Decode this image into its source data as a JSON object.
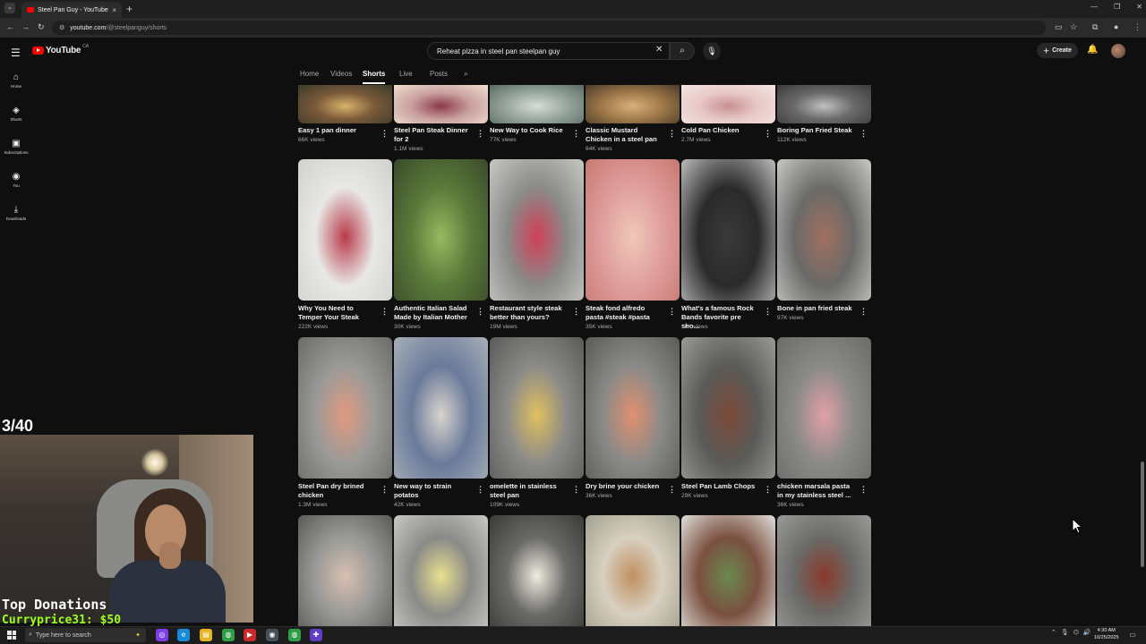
{
  "browser": {
    "tab_title": "Steel Pan Guy - YouTube",
    "url_host": "youtube.com",
    "url_path": "/@steelpanguy/shorts",
    "new_tab": "+",
    "close": "×"
  },
  "masthead": {
    "logo_text": "YouTube",
    "logo_region": "CA",
    "search_value": "Reheat pizza in steel pan steelpan guy",
    "create_label": "Create"
  },
  "sidebar": {
    "items": [
      {
        "label": "Home",
        "icon": "home-icon"
      },
      {
        "label": "Shorts",
        "icon": "shorts-icon"
      },
      {
        "label": "Subscriptions",
        "icon": "subscriptions-icon"
      },
      {
        "label": "You",
        "icon": "you-icon"
      },
      {
        "label": "Downloads",
        "icon": "downloads-icon"
      }
    ]
  },
  "channel_tabs": [
    "Home",
    "Videos",
    "Shorts",
    "Live",
    "Posts"
  ],
  "active_tab": "Shorts",
  "shorts": {
    "row1": [
      {
        "title": "Easy 1 pan dinner",
        "views": "66K views"
      },
      {
        "title": "Steel Pan Steak Dinner for 2",
        "views": "1.1M views"
      },
      {
        "title": "New Way to Cook Rice",
        "views": "77K views"
      },
      {
        "title": "Classic Mustard Chicken in a steel pan",
        "views": "64K views"
      },
      {
        "title": "Cold Pan Chicken",
        "views": "2.7M views"
      },
      {
        "title": "Boring Pan Fried Steak",
        "views": "112K views"
      }
    ],
    "row2": [
      {
        "title": "Why You Need to Temper Your Steak",
        "views": "222K views"
      },
      {
        "title": "Authentic Italian Salad Made by Italian Mother",
        "views": "30K views"
      },
      {
        "title": "Restaurant style steak better than yours?",
        "views": "19M views"
      },
      {
        "title": "Steak fond alfredo pasta #steak #pasta",
        "views": "35K views"
      },
      {
        "title": "What's a famous Rock Bands favorite pre sho...",
        "views": "30K views"
      },
      {
        "title": "Bone in pan fried steak",
        "views": "97K views"
      }
    ],
    "row3": [
      {
        "title": "Steel Pan dry brined chicken",
        "views": "1.3M views"
      },
      {
        "title": "New way to strain potatos",
        "views": "42K views"
      },
      {
        "title": "omelette in stainless steel pan",
        "views": "109K views"
      },
      {
        "title": "Dry brine your chicken",
        "views": "36K views"
      },
      {
        "title": "Steel Pan Lamb Chops",
        "views": "29K views"
      },
      {
        "title": "chicken marsala pasta in my stainless steel ...",
        "views": "36K views"
      }
    ]
  },
  "overlay": {
    "counter": "3/40",
    "donations_title": "Top Donations",
    "donation_entry": "Curryprice31: $50"
  },
  "taskbar": {
    "search_placeholder": "Type here to search",
    "time": "4:30 AM",
    "date": "10/25/2025"
  },
  "colors": {
    "background": "#0f0f0f",
    "accent_red": "#ff0000",
    "donation_green": "#9cff1a"
  }
}
